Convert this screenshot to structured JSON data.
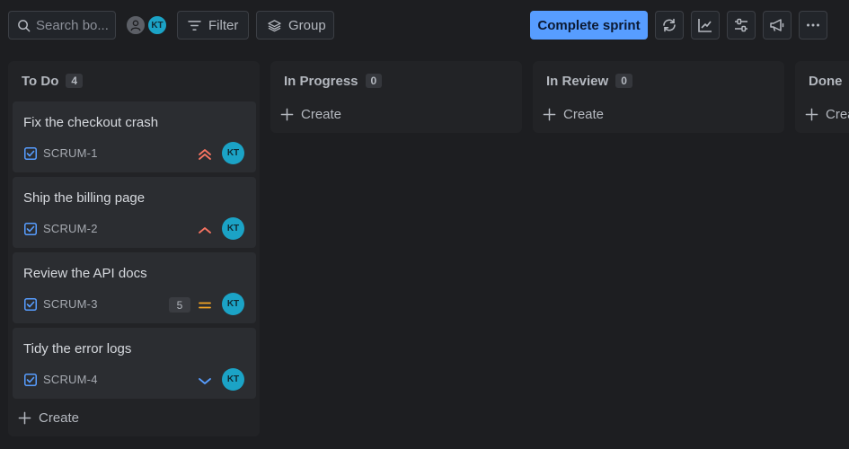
{
  "toolbar": {
    "search_placeholder": "Search bo...",
    "avatar_initials": "KT",
    "filter_label": "Filter",
    "group_label": "Group",
    "complete_sprint_label": "Complete sprint",
    "icons": [
      "refresh-icon",
      "insights-chart-icon",
      "view-settings-icon",
      "megaphone-icon",
      "more-icon"
    ]
  },
  "columns": [
    {
      "title": "To Do",
      "count": "4",
      "create_label": "Create",
      "cards": [
        {
          "title": "Fix the checkout crash",
          "key": "SCRUM-1",
          "priority": "highest",
          "estimate": "",
          "assignee": "KT"
        },
        {
          "title": "Ship the billing page",
          "key": "SCRUM-2",
          "priority": "high",
          "estimate": "",
          "assignee": "KT"
        },
        {
          "title": "Review the API docs",
          "key": "SCRUM-3",
          "priority": "medium",
          "estimate": "5",
          "assignee": "KT"
        },
        {
          "title": "Tidy the error logs",
          "key": "SCRUM-4",
          "priority": "low",
          "estimate": "",
          "assignee": "KT"
        }
      ]
    },
    {
      "title": "In Progress",
      "count": "0",
      "create_label": "Create",
      "cards": []
    },
    {
      "title": "In Review",
      "count": "0",
      "create_label": "Create",
      "cards": []
    },
    {
      "title": "Done",
      "count": "",
      "create_label": "Create",
      "cards": []
    }
  ],
  "colors": {
    "accent": "#579dff",
    "avatar": "#1ba3c6",
    "priority_highest": "#f87462",
    "priority_medium": "#f5a524",
    "priority_low": "#579dff",
    "checkbox": "#579dff"
  }
}
